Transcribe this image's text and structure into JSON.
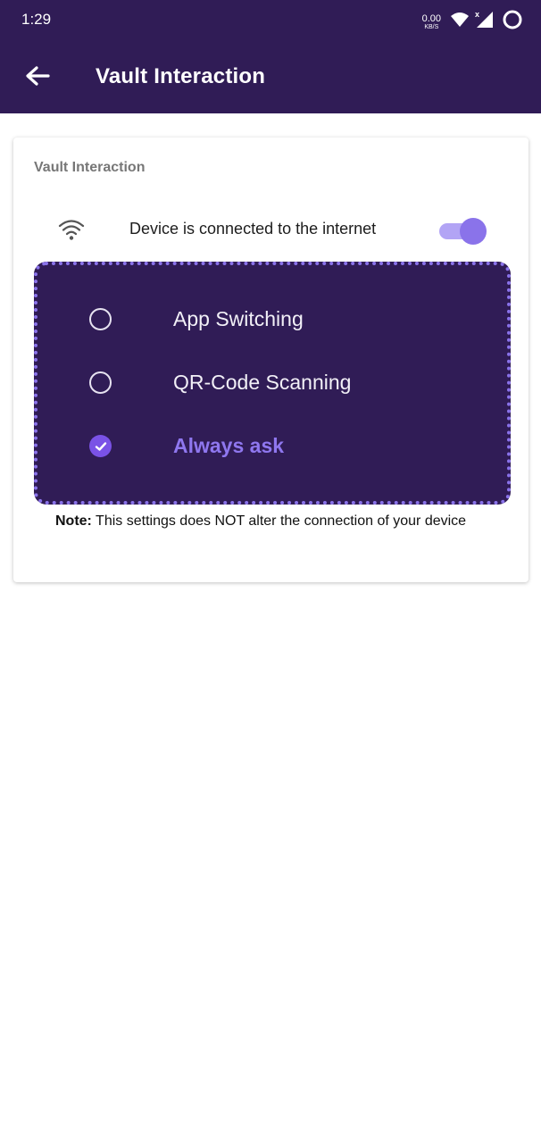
{
  "status_bar": {
    "time": "1:29",
    "net_speed_value": "0.00",
    "net_speed_unit": "KB/S",
    "icons": [
      "wifi-icon",
      "signal-icon",
      "battery-ring-icon"
    ]
  },
  "app_bar": {
    "title": "Vault Interaction",
    "back_icon": "arrow-left-icon"
  },
  "card": {
    "title": "Vault Interaction",
    "toggle": {
      "icon": "wifi-icon",
      "label": "Device is connected to the internet",
      "on": true
    },
    "options": [
      {
        "label": "App Switching",
        "selected": false
      },
      {
        "label": "QR-Code Scanning",
        "selected": false
      },
      {
        "label": "Always ask",
        "selected": true
      }
    ],
    "note_bold": "Note:",
    "note_text": "This settings does NOT alter the connection of your device"
  },
  "colors": {
    "app_bar_bg": "#301c56",
    "accent": "#8a73ea",
    "selected_text": "#8f77ef",
    "toggle_track": "#b2a4f5"
  }
}
